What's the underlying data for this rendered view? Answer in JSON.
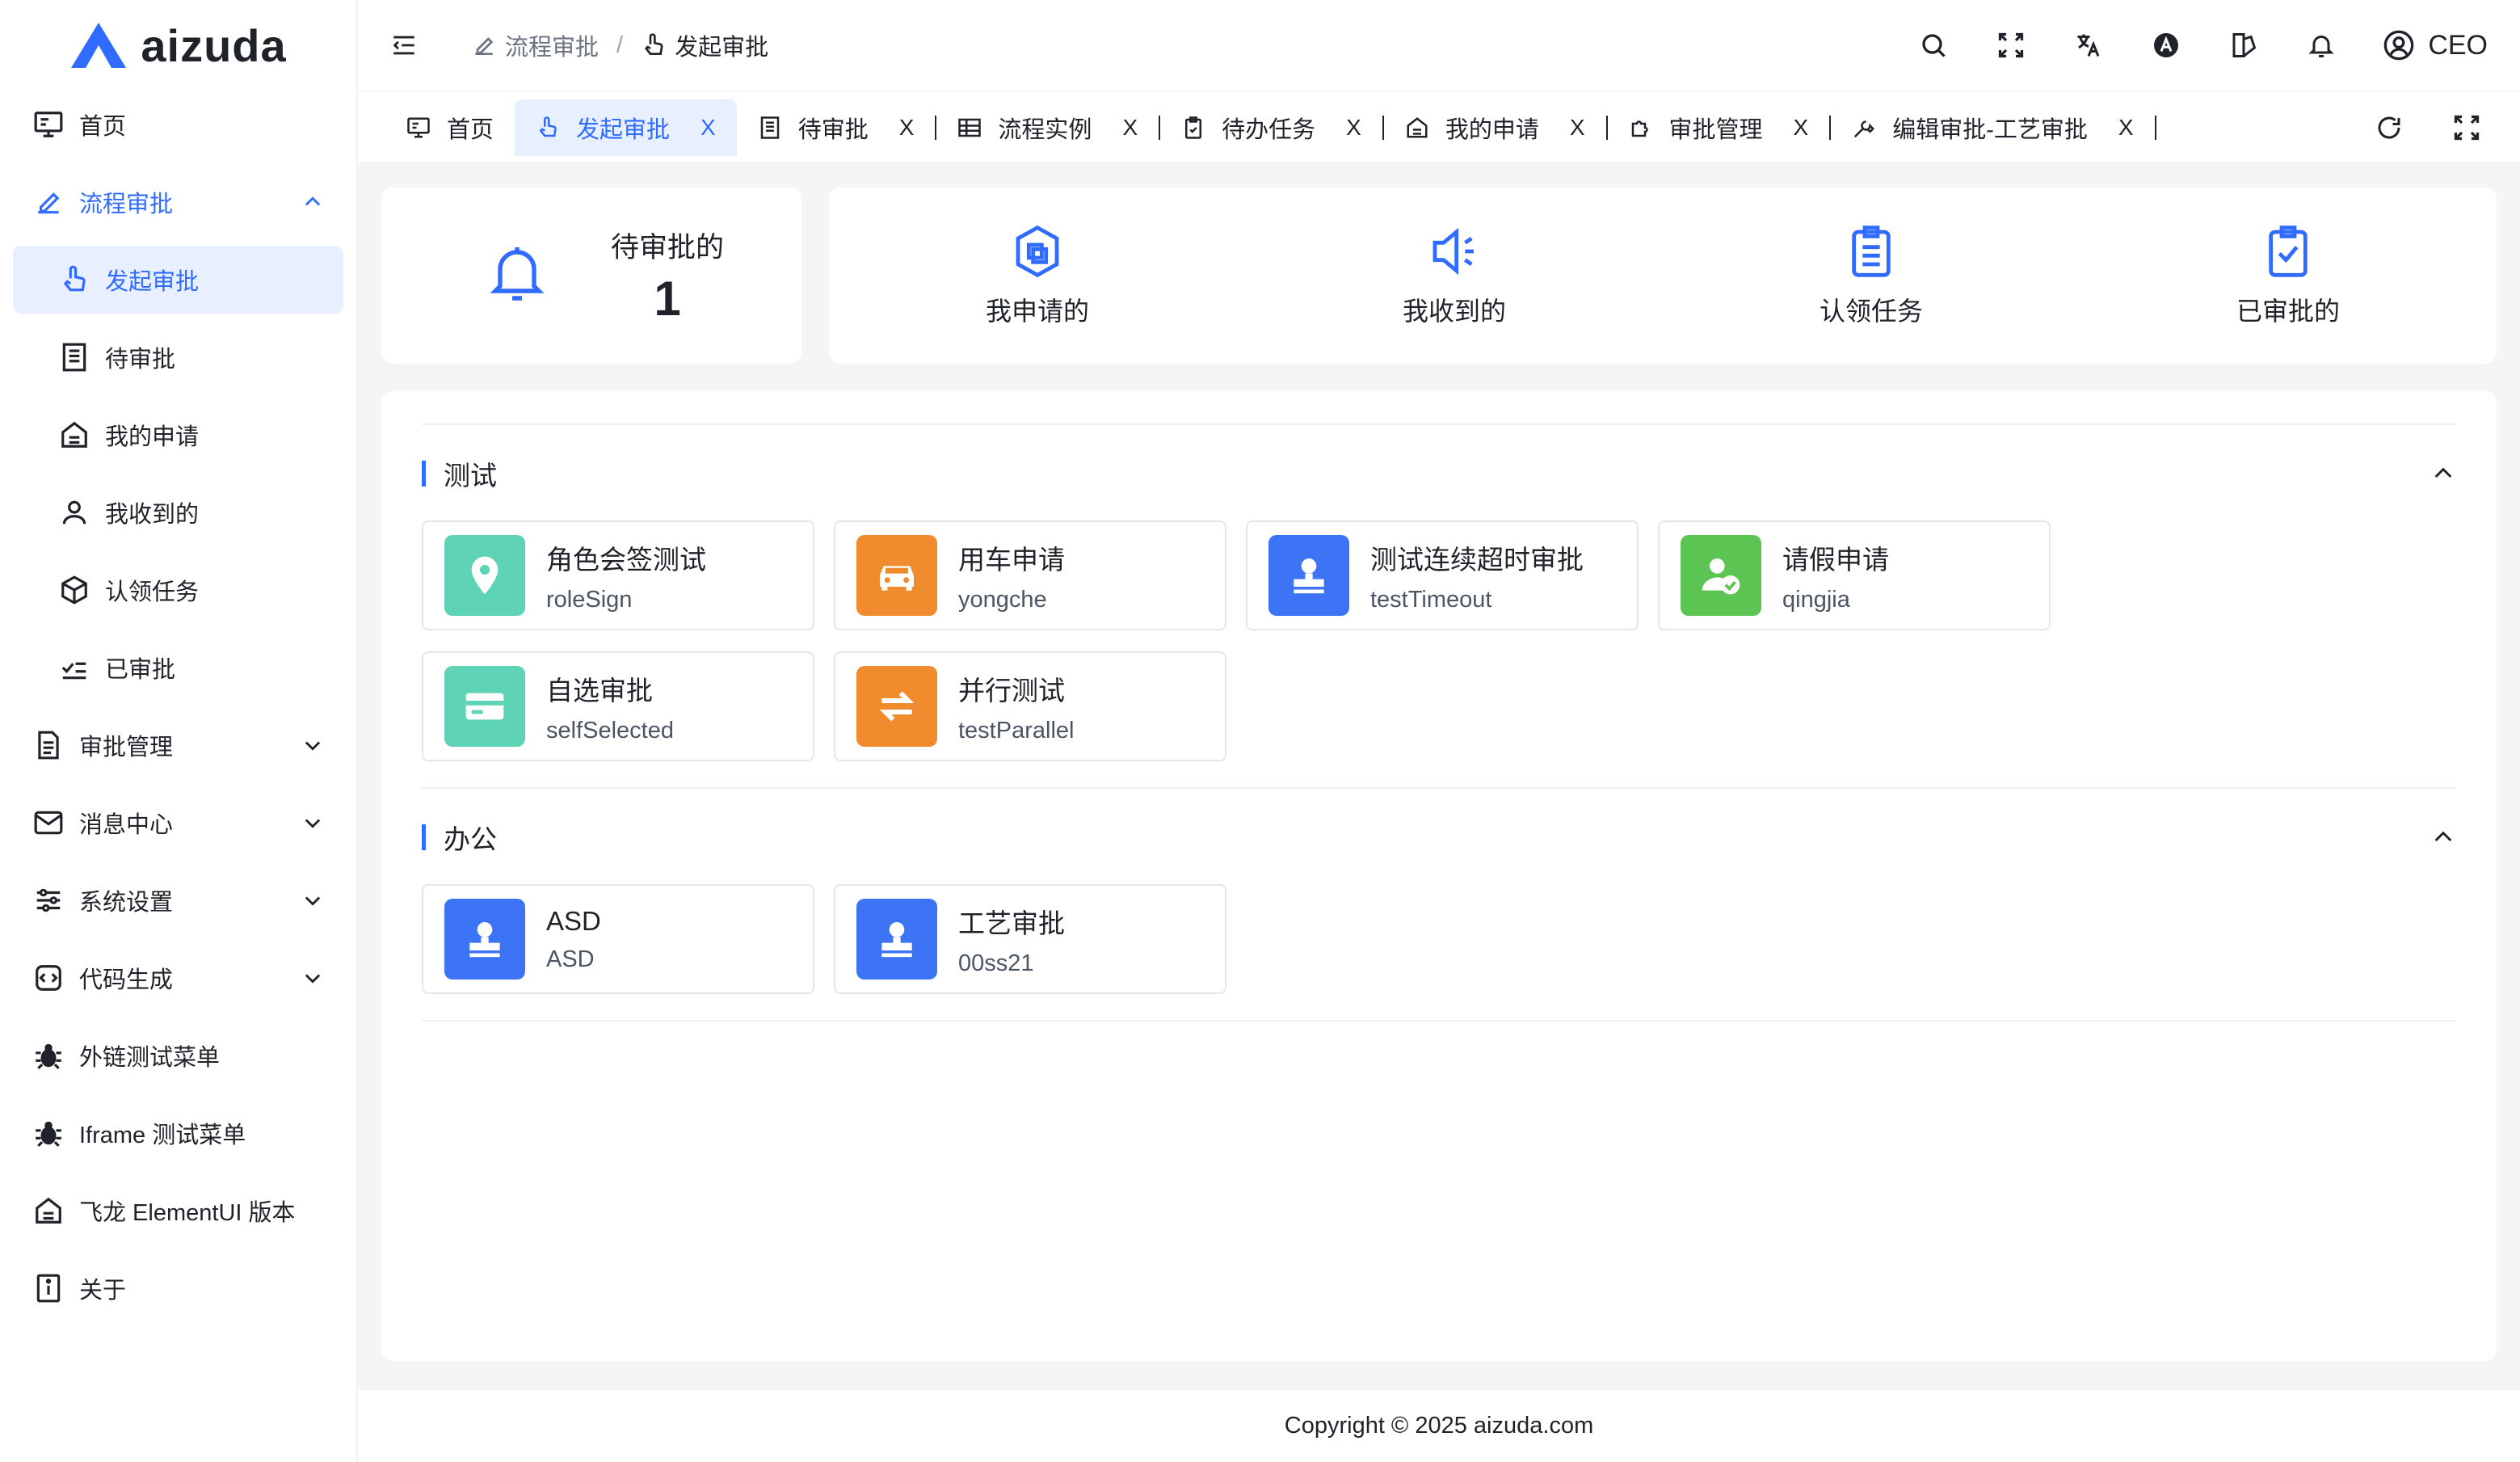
{
  "brand": {
    "name": "aizuda",
    "accent": "#2f6bff"
  },
  "sidebar": {
    "items": [
      {
        "label": "首页",
        "icon": "monitor-icon"
      },
      {
        "label": "流程审批",
        "icon": "edit-pen-icon",
        "expanded": true
      },
      {
        "label": "发起审批",
        "icon": "pointer-hand-icon",
        "active": true
      },
      {
        "label": "待审批",
        "icon": "document-list-icon"
      },
      {
        "label": "我的申请",
        "icon": "house-doc-icon"
      },
      {
        "label": "我收到的",
        "icon": "user-icon"
      },
      {
        "label": "认领任务",
        "icon": "box-icon"
      },
      {
        "label": "已审批",
        "icon": "checklist-icon"
      },
      {
        "label": "审批管理",
        "icon": "document-icon"
      },
      {
        "label": "消息中心",
        "icon": "mail-icon"
      },
      {
        "label": "系统设置",
        "icon": "sliders-icon"
      },
      {
        "label": "代码生成",
        "icon": "code-icon"
      },
      {
        "label": "外链测试菜单",
        "icon": "bug-icon"
      },
      {
        "label": "Iframe 测试菜单",
        "icon": "bug-icon"
      },
      {
        "label": "飞龙 ElementUI 版本",
        "icon": "house-doc-icon"
      },
      {
        "label": "关于",
        "icon": "info-icon"
      }
    ]
  },
  "header": {
    "breadcrumb": [
      "流程审批",
      "/",
      "发起审批"
    ],
    "user": "CEO"
  },
  "tabs": [
    {
      "label": "首页",
      "icon": "monitor-icon"
    },
    {
      "label": "发起审批",
      "icon": "pointer-hand-icon",
      "active": true,
      "close": "X"
    },
    {
      "label": "待审批",
      "icon": "document-list-icon",
      "close": "X"
    },
    {
      "label": "流程实例",
      "icon": "table-icon",
      "close": "X"
    },
    {
      "label": "待办任务",
      "icon": "clipboard-icon",
      "close": "X"
    },
    {
      "label": "我的申请",
      "icon": "house-doc-icon",
      "close": "X"
    },
    {
      "label": "审批管理",
      "icon": "puzzle-icon",
      "close": "X"
    },
    {
      "label": "编辑审批-工艺审批",
      "icon": "tools-icon",
      "close": "X"
    }
  ],
  "summary": {
    "pending_label": "待审批的",
    "pending_count": "1",
    "quick": [
      "我申请的",
      "我收到的",
      "认领任务",
      "已审批的"
    ]
  },
  "groups": [
    {
      "title": "测试",
      "items": [
        {
          "name": "角色会签测试",
          "code": "roleSign",
          "color": "#5fd3b5",
          "icon": "location-pin-icon"
        },
        {
          "name": "用车申请",
          "code": "yongche",
          "color": "#f08c2e",
          "icon": "car-icon"
        },
        {
          "name": "测试连续超时审批",
          "code": "testTimeout",
          "color": "#3d73f5",
          "icon": "stamp-icon"
        },
        {
          "name": "请假申请",
          "code": "qingjia",
          "color": "#5cc453",
          "icon": "user-check-icon"
        },
        {
          "name": "自选审批",
          "code": "selfSelected",
          "color": "#5fd3b5",
          "icon": "card-icon"
        },
        {
          "name": "并行测试",
          "code": "testParallel",
          "color": "#f08c2e",
          "icon": "swap-icon"
        }
      ]
    },
    {
      "title": "办公",
      "items": [
        {
          "name": "ASD",
          "code": "ASD",
          "color": "#3d73f5",
          "icon": "stamp-icon"
        },
        {
          "name": "工艺审批",
          "code": "00ss21",
          "color": "#3d73f5",
          "icon": "stamp-icon"
        }
      ]
    }
  ],
  "footer": {
    "copyright": "Copyright © 2025 aizuda.com"
  }
}
